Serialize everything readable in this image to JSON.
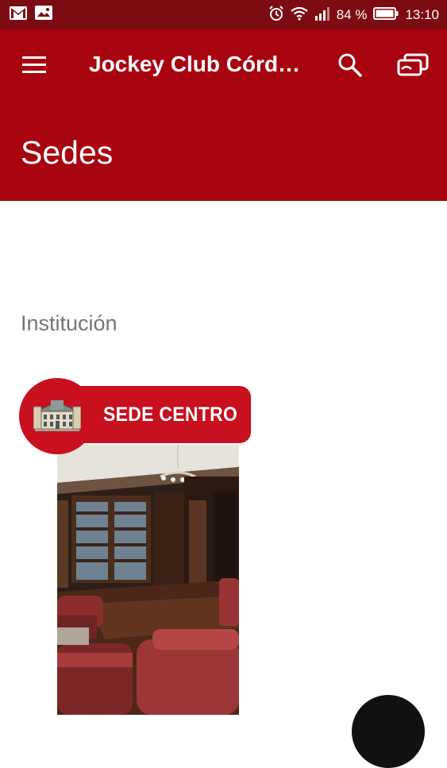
{
  "status_bar": {
    "battery_percent": "84 %",
    "time": "13:10",
    "icons": [
      "gmail-icon",
      "gallery-icon",
      "alarm-icon",
      "wifi-icon",
      "signal-icon",
      "battery-icon"
    ]
  },
  "toolbar": {
    "title": "Jockey Club Córd…",
    "page_title": "Sedes",
    "icons": [
      "menu-icon",
      "search-icon",
      "cards-icon"
    ],
    "color": "#a80511"
  },
  "content": {
    "section_label": "Institución",
    "card": {
      "banner_text": "SEDE CENTRO",
      "banner_color": "#c8101e"
    }
  }
}
